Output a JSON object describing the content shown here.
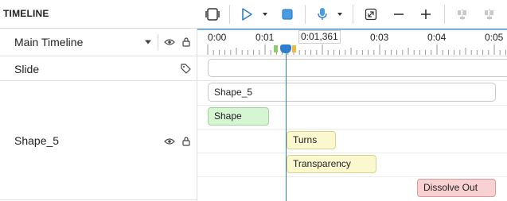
{
  "toolbar": {
    "title": "TIMELINE"
  },
  "timeline_selector": {
    "value": "Main Timeline"
  },
  "rows": {
    "slide_label": "Slide",
    "shape_label": "Shape_5"
  },
  "ruler": {
    "ticks": [
      "0:00",
      "0:01",
      "0:03",
      "0:04",
      "0:05"
    ],
    "current_time": "0:01,361"
  },
  "tracks": {
    "shape_object": "Shape_5",
    "animations": [
      {
        "label": "Shape"
      },
      {
        "label": "Turns"
      },
      {
        "label": "Transparency"
      },
      {
        "label": "Dissolve Out"
      }
    ]
  },
  "colors": {
    "accent": "#2f7fd0",
    "anim_green": "#d6f5d3",
    "anim_yellow": "#fbf8cf",
    "anim_red": "#f8d2d2"
  }
}
